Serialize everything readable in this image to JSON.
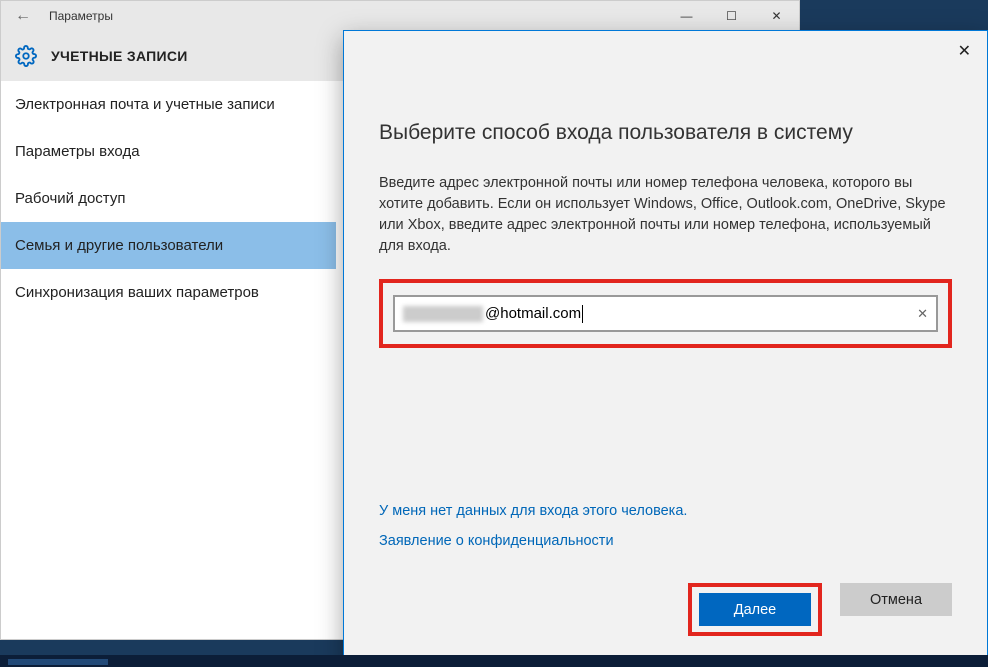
{
  "window": {
    "title": "Параметры",
    "controls": {
      "minimize": "—",
      "maximize": "☐",
      "close": "✕"
    }
  },
  "header": {
    "title": "УЧЕТНЫЕ ЗАПИСИ"
  },
  "sidebar": {
    "items": [
      {
        "label": "Электронная почта и учетные записи",
        "active": false
      },
      {
        "label": "Параметры входа",
        "active": false
      },
      {
        "label": "Рабочий доступ",
        "active": false
      },
      {
        "label": "Семья и другие пользователи",
        "active": true
      },
      {
        "label": "Синхронизация ваших параметров",
        "active": false
      }
    ]
  },
  "modal": {
    "title": "Выберите способ входа пользователя в систему",
    "description": "Введите адрес электронной почты или номер телефона человека, которого вы хотите добавить. Если он использует Windows, Office, Outlook.com, OneDrive, Skype или Xbox, введите адрес электронной почты или номер телефона, используемый для входа.",
    "input_value": "@hotmail.com",
    "link_no_data": "У меня нет данных для входа этого человека.",
    "link_privacy": "Заявление о конфиденциальности",
    "btn_next": "Далее",
    "btn_cancel": "Отмена"
  },
  "colors": {
    "highlight": "#e2261e",
    "accent": "#0067c0",
    "link": "#0067b8"
  }
}
